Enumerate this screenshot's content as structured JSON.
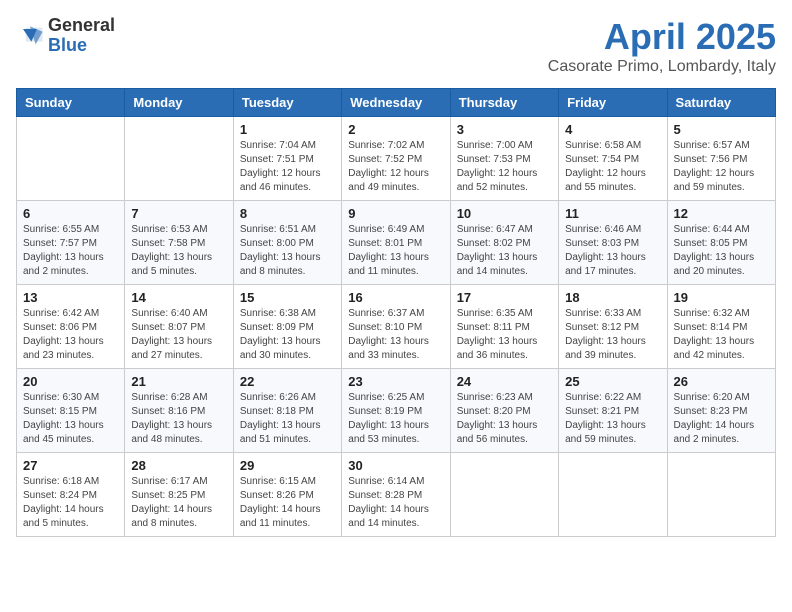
{
  "logo": {
    "general": "General",
    "blue": "Blue"
  },
  "header": {
    "title": "April 2025",
    "subtitle": "Casorate Primo, Lombardy, Italy"
  },
  "days_of_week": [
    "Sunday",
    "Monday",
    "Tuesday",
    "Wednesday",
    "Thursday",
    "Friday",
    "Saturday"
  ],
  "weeks": [
    [
      {
        "day": "",
        "info": ""
      },
      {
        "day": "",
        "info": ""
      },
      {
        "day": "1",
        "info": "Sunrise: 7:04 AM\nSunset: 7:51 PM\nDaylight: 12 hours and 46 minutes."
      },
      {
        "day": "2",
        "info": "Sunrise: 7:02 AM\nSunset: 7:52 PM\nDaylight: 12 hours and 49 minutes."
      },
      {
        "day": "3",
        "info": "Sunrise: 7:00 AM\nSunset: 7:53 PM\nDaylight: 12 hours and 52 minutes."
      },
      {
        "day": "4",
        "info": "Sunrise: 6:58 AM\nSunset: 7:54 PM\nDaylight: 12 hours and 55 minutes."
      },
      {
        "day": "5",
        "info": "Sunrise: 6:57 AM\nSunset: 7:56 PM\nDaylight: 12 hours and 59 minutes."
      }
    ],
    [
      {
        "day": "6",
        "info": "Sunrise: 6:55 AM\nSunset: 7:57 PM\nDaylight: 13 hours and 2 minutes."
      },
      {
        "day": "7",
        "info": "Sunrise: 6:53 AM\nSunset: 7:58 PM\nDaylight: 13 hours and 5 minutes."
      },
      {
        "day": "8",
        "info": "Sunrise: 6:51 AM\nSunset: 8:00 PM\nDaylight: 13 hours and 8 minutes."
      },
      {
        "day": "9",
        "info": "Sunrise: 6:49 AM\nSunset: 8:01 PM\nDaylight: 13 hours and 11 minutes."
      },
      {
        "day": "10",
        "info": "Sunrise: 6:47 AM\nSunset: 8:02 PM\nDaylight: 13 hours and 14 minutes."
      },
      {
        "day": "11",
        "info": "Sunrise: 6:46 AM\nSunset: 8:03 PM\nDaylight: 13 hours and 17 minutes."
      },
      {
        "day": "12",
        "info": "Sunrise: 6:44 AM\nSunset: 8:05 PM\nDaylight: 13 hours and 20 minutes."
      }
    ],
    [
      {
        "day": "13",
        "info": "Sunrise: 6:42 AM\nSunset: 8:06 PM\nDaylight: 13 hours and 23 minutes."
      },
      {
        "day": "14",
        "info": "Sunrise: 6:40 AM\nSunset: 8:07 PM\nDaylight: 13 hours and 27 minutes."
      },
      {
        "day": "15",
        "info": "Sunrise: 6:38 AM\nSunset: 8:09 PM\nDaylight: 13 hours and 30 minutes."
      },
      {
        "day": "16",
        "info": "Sunrise: 6:37 AM\nSunset: 8:10 PM\nDaylight: 13 hours and 33 minutes."
      },
      {
        "day": "17",
        "info": "Sunrise: 6:35 AM\nSunset: 8:11 PM\nDaylight: 13 hours and 36 minutes."
      },
      {
        "day": "18",
        "info": "Sunrise: 6:33 AM\nSunset: 8:12 PM\nDaylight: 13 hours and 39 minutes."
      },
      {
        "day": "19",
        "info": "Sunrise: 6:32 AM\nSunset: 8:14 PM\nDaylight: 13 hours and 42 minutes."
      }
    ],
    [
      {
        "day": "20",
        "info": "Sunrise: 6:30 AM\nSunset: 8:15 PM\nDaylight: 13 hours and 45 minutes."
      },
      {
        "day": "21",
        "info": "Sunrise: 6:28 AM\nSunset: 8:16 PM\nDaylight: 13 hours and 48 minutes."
      },
      {
        "day": "22",
        "info": "Sunrise: 6:26 AM\nSunset: 8:18 PM\nDaylight: 13 hours and 51 minutes."
      },
      {
        "day": "23",
        "info": "Sunrise: 6:25 AM\nSunset: 8:19 PM\nDaylight: 13 hours and 53 minutes."
      },
      {
        "day": "24",
        "info": "Sunrise: 6:23 AM\nSunset: 8:20 PM\nDaylight: 13 hours and 56 minutes."
      },
      {
        "day": "25",
        "info": "Sunrise: 6:22 AM\nSunset: 8:21 PM\nDaylight: 13 hours and 59 minutes."
      },
      {
        "day": "26",
        "info": "Sunrise: 6:20 AM\nSunset: 8:23 PM\nDaylight: 14 hours and 2 minutes."
      }
    ],
    [
      {
        "day": "27",
        "info": "Sunrise: 6:18 AM\nSunset: 8:24 PM\nDaylight: 14 hours and 5 minutes."
      },
      {
        "day": "28",
        "info": "Sunrise: 6:17 AM\nSunset: 8:25 PM\nDaylight: 14 hours and 8 minutes."
      },
      {
        "day": "29",
        "info": "Sunrise: 6:15 AM\nSunset: 8:26 PM\nDaylight: 14 hours and 11 minutes."
      },
      {
        "day": "30",
        "info": "Sunrise: 6:14 AM\nSunset: 8:28 PM\nDaylight: 14 hours and 14 minutes."
      },
      {
        "day": "",
        "info": ""
      },
      {
        "day": "",
        "info": ""
      },
      {
        "day": "",
        "info": ""
      }
    ]
  ]
}
